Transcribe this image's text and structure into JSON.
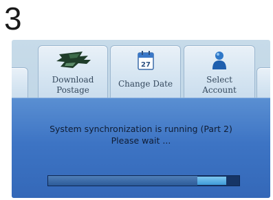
{
  "step": {
    "number": "3"
  },
  "tabs": [
    {
      "label_line1": "Download",
      "label_line2": "Postage",
      "icon": "download-postage-icon"
    },
    {
      "label_line1": "Change Date",
      "label_line2": "",
      "icon": "calendar-icon",
      "calendar_day": "27"
    },
    {
      "label_line1": "Select",
      "label_line2": "Account",
      "icon": "user-account-icon"
    }
  ],
  "panel": {
    "message_line1": "System synchronization is running (Part 2)",
    "message_line2": "Please wait ..."
  },
  "progress": {
    "value": 0.78,
    "active_segment": [
      0.78,
      0.93
    ]
  },
  "colors": {
    "panel_top": "#5a8fd2",
    "panel_bottom": "#3468b8",
    "track": "#163566",
    "highlight": "#58b4e8"
  }
}
